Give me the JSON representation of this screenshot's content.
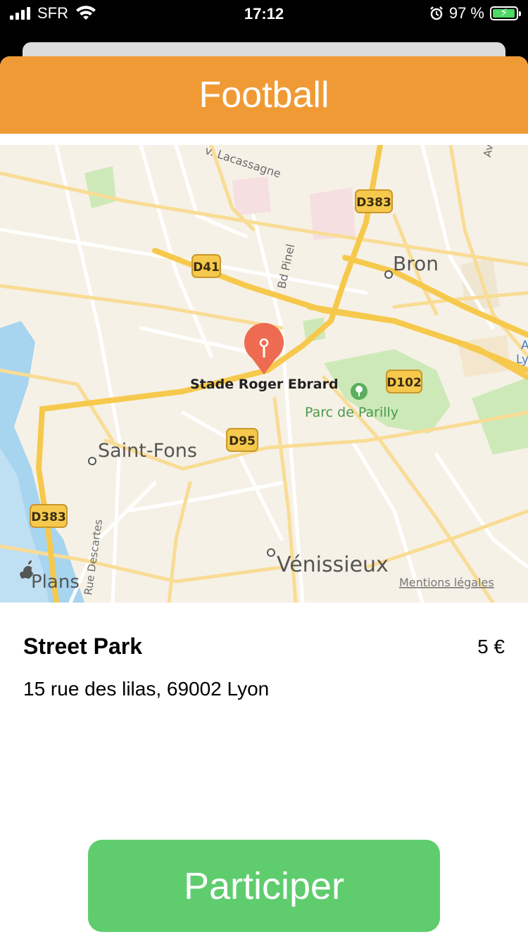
{
  "status_bar": {
    "carrier": "SFR",
    "time": "17:12",
    "battery_pct": "97 %",
    "battery_level": 0.97
  },
  "header": {
    "title": "Football"
  },
  "map": {
    "labels": {
      "road_lacassagne": "v. Lacassagne",
      "road_d383_top": "D383",
      "road_d41": "D41",
      "road_bd_pinel": "Bd Pinel",
      "city_bron": "Bron",
      "stadium": "Stade Roger Ebrard",
      "road_d102": "D102",
      "park": "Parc de Parilly",
      "city_saint_fons": "Saint-Fons",
      "road_d95": "D95",
      "road_d383_left": "D383",
      "road_rue_descartes": "Rue Descartes",
      "city_venissieux": "Vénissieux",
      "edge_a": "A",
      "edge_ly": "Ly",
      "edge_av": "Av"
    },
    "brand": "Plans",
    "legal": "Mentions légales"
  },
  "place": {
    "name": "Street Park",
    "price": "5 €",
    "address": "15 rue des lilas, 69002 Lyon"
  },
  "action": {
    "label": "Participer"
  },
  "colors": {
    "header": "#f09a36",
    "button": "#5fcd6e",
    "pin": "#ee6a50",
    "road": "#f6d16b",
    "map_bg": "#f6f1e6",
    "water": "#a7d4ef",
    "park": "#cde9b8"
  }
}
